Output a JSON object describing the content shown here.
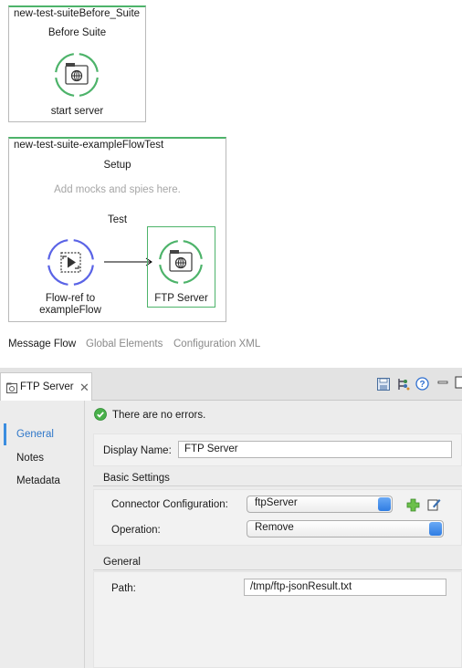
{
  "canvas": {
    "before_suite": {
      "title": "new-test-suiteBefore_Suite",
      "section_label": "Before Suite",
      "node_label": "start server"
    },
    "test_scope": {
      "title": "new-test-suite-exampleFlowTest",
      "setup_label": "Setup",
      "setup_hint": "Add mocks and spies here.",
      "test_label": "Test",
      "flow_ref_label_line1": "Flow-ref to",
      "flow_ref_label_line2": "exampleFlow",
      "ftp_node_label": "FTP Server"
    },
    "colors": {
      "accent_green": "#4db36a",
      "flowref_blue": "#5a63e6"
    }
  },
  "bottom_tabs": [
    "Message Flow",
    "Global Elements",
    "Configuration XML"
  ],
  "properties": {
    "tab_label": "FTP Server",
    "toolbar_icons": [
      "save-icon",
      "tree-icon",
      "help-icon",
      "minimize-icon",
      "maximize-icon"
    ],
    "nav": [
      "General",
      "Notes",
      "Metadata"
    ],
    "status_text": "There are no errors.",
    "display_name_label": "Display Name:",
    "display_name_value": "FTP Server",
    "basic_settings_label": "Basic Settings",
    "connector_config_label": "Connector Configuration:",
    "connector_config_value": "ftpServer",
    "operation_label": "Operation:",
    "operation_value": "Remove",
    "general_label": "General",
    "path_label": "Path:",
    "path_value": "/tmp/ftp-jsonResult.txt"
  }
}
